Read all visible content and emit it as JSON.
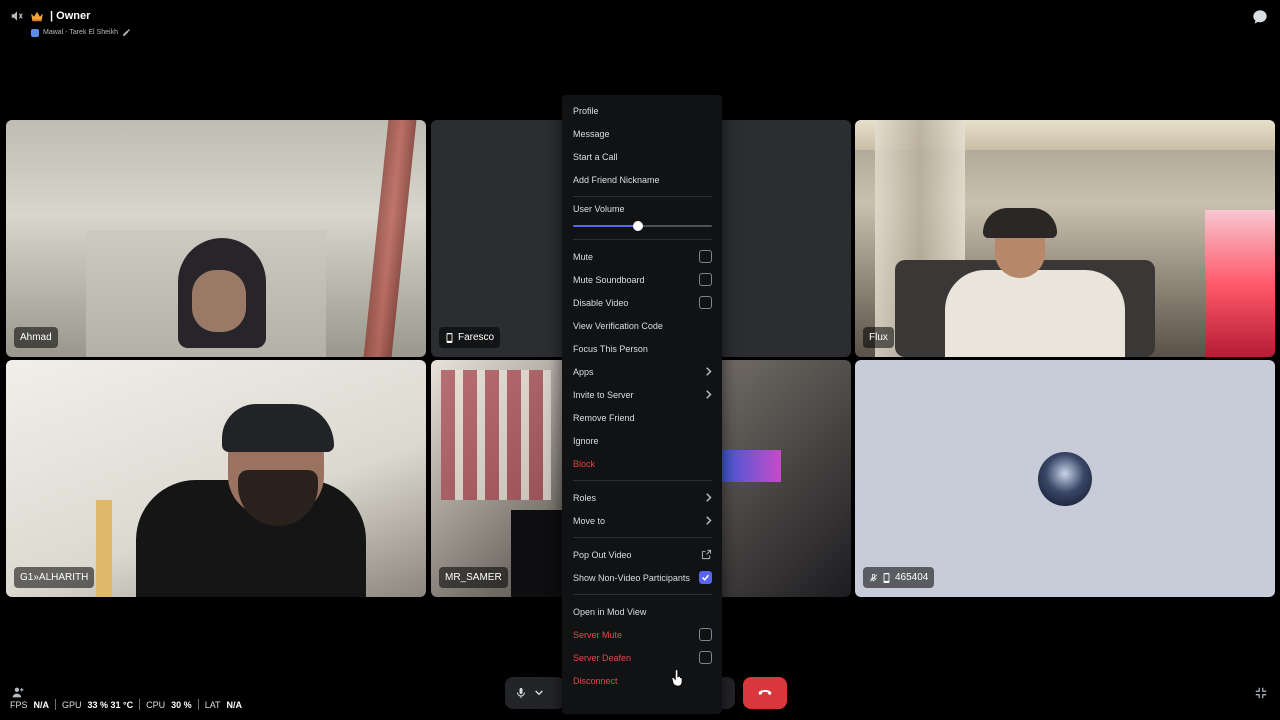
{
  "header": {
    "channel_title": "| Owner",
    "status_text": "Mawal - Tarek El Sheikh"
  },
  "tiles": [
    {
      "name": "Ahmad",
      "has_video": true,
      "icon": null
    },
    {
      "name": "Faresco",
      "has_video": false,
      "icon": "mobile-icon"
    },
    {
      "name": "Flux",
      "has_video": true,
      "icon": null
    },
    {
      "name": "G1»ALHARITH",
      "has_video": true,
      "icon": null
    },
    {
      "name": "MR_SAMER",
      "has_video": true,
      "icon": null
    },
    {
      "name": "465404",
      "has_video": false,
      "icon": "mic-muted-icon mobile-icon"
    }
  ],
  "stats": {
    "fps_label": "FPS",
    "fps_value": "N/A",
    "gpu_label": "GPU",
    "gpu_value": "33 % 31 °C",
    "cpu_label": "CPU",
    "cpu_value": "30 %",
    "lat_label": "LAT",
    "lat_value": "N/A"
  },
  "menu": {
    "items_top": [
      "Profile",
      "Message",
      "Start a Call",
      "Add Friend Nickname"
    ],
    "user_volume_label": "User Volume",
    "user_volume_fraction": 0.47,
    "mute": "Mute",
    "mute_soundboard": "Mute Soundboard",
    "disable_video": "Disable Video",
    "view_verification_code": "View Verification Code",
    "focus_this_person": "Focus This Person",
    "apps": "Apps",
    "invite_to_server": "Invite to Server",
    "remove_friend": "Remove Friend",
    "ignore": "Ignore",
    "block": "Block",
    "roles": "Roles",
    "move_to": "Move to",
    "pop_out_video": "Pop Out Video",
    "show_non_video": "Show Non-Video Participants",
    "show_non_video_checked": true,
    "open_mod_view": "Open in Mod View",
    "server_mute": "Server Mute",
    "server_deafen": "Server Deafen",
    "disconnect": "Disconnect"
  },
  "colors": {
    "accent": "#5865f2",
    "danger": "#f23f43",
    "hangup": "#da373c",
    "menu_bg": "#111214"
  }
}
